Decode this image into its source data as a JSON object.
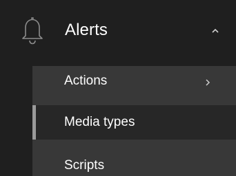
{
  "section": {
    "label": "Alerts",
    "icon": "bell-icon",
    "expanded_icon": "chevron-up-icon"
  },
  "submenu": {
    "items": [
      {
        "label": "Actions",
        "has_children": true,
        "icon": "chevron-right-icon",
        "active": false
      },
      {
        "label": "Media types",
        "has_children": false,
        "active": true
      },
      {
        "label": "Scripts",
        "has_children": false,
        "active": false
      }
    ]
  },
  "colors": {
    "background": "#1f1f1f",
    "submenu_background": "#383838",
    "active_background": "#272727",
    "active_indicator": "#9a9a9a",
    "text": "#ffffff"
  }
}
